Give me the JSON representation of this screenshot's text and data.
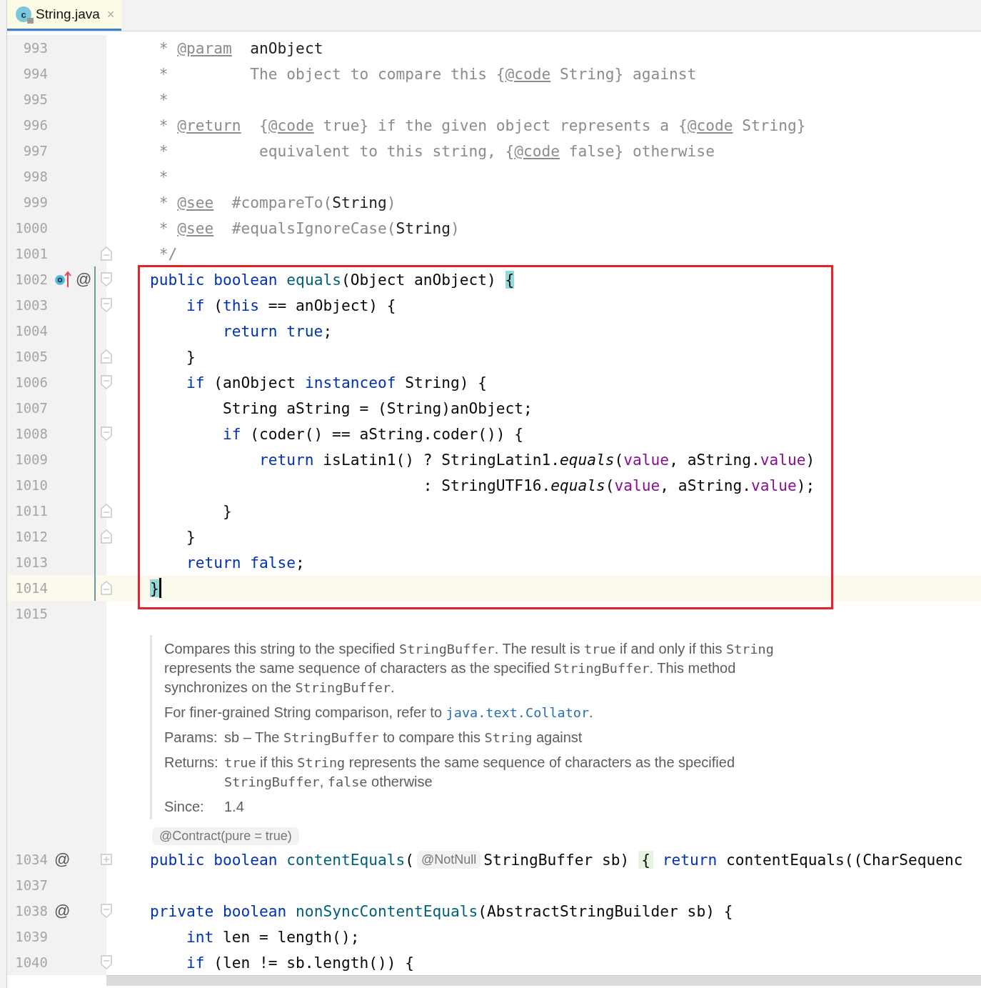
{
  "tab": {
    "label": "String.java",
    "icon_text": "c",
    "close": "×",
    "selected": true
  },
  "lines": [
    {
      "number": "993",
      "tokens": [
        {
          "kind": "comment",
          "text": " * "
        },
        {
          "kind": "doctag",
          "text": "@param"
        },
        {
          "kind": "docref",
          "text": "  anObject"
        }
      ]
    },
    {
      "number": "994",
      "tokens": [
        {
          "kind": "comment",
          "text": " *         The object to compare this {"
        },
        {
          "kind": "doctag",
          "text": "@code"
        },
        {
          "kind": "comment",
          "text": " String} against"
        }
      ]
    },
    {
      "number": "995",
      "tokens": [
        {
          "kind": "comment",
          "text": " *"
        }
      ]
    },
    {
      "number": "996",
      "tokens": [
        {
          "kind": "comment",
          "text": " * "
        },
        {
          "kind": "doctag",
          "text": "@return"
        },
        {
          "kind": "comment",
          "text": "  {"
        },
        {
          "kind": "doctag",
          "text": "@code"
        },
        {
          "kind": "comment",
          "text": " true} if the given object represents a {"
        },
        {
          "kind": "doctag",
          "text": "@code"
        },
        {
          "kind": "comment",
          "text": " String}"
        }
      ]
    },
    {
      "number": "997",
      "tokens": [
        {
          "kind": "comment",
          "text": " *          equivalent to this string, {"
        },
        {
          "kind": "doctag",
          "text": "@code"
        },
        {
          "kind": "comment",
          "text": " false} otherwise"
        }
      ]
    },
    {
      "number": "998",
      "tokens": [
        {
          "kind": "comment",
          "text": " *"
        }
      ]
    },
    {
      "number": "999",
      "tokens": [
        {
          "kind": "comment",
          "text": " * "
        },
        {
          "kind": "doctag",
          "text": "@see"
        },
        {
          "kind": "comment",
          "text": "  #compareTo("
        },
        {
          "kind": "docref",
          "text": "String"
        },
        {
          "kind": "comment",
          "text": ")"
        }
      ]
    },
    {
      "number": "1000",
      "tokens": [
        {
          "kind": "comment",
          "text": " * "
        },
        {
          "kind": "doctag",
          "text": "@see"
        },
        {
          "kind": "comment",
          "text": "  #equalsIgnoreCase("
        },
        {
          "kind": "docref",
          "text": "String"
        },
        {
          "kind": "comment",
          "text": ")"
        }
      ]
    },
    {
      "number": "1001",
      "fold": {
        "kind": "end"
      },
      "tokens": [
        {
          "kind": "comment",
          "text": " */"
        }
      ]
    },
    {
      "kind": "frame",
      "lines": [
        {
          "number": "1002",
          "fold": {
            "kind": "start"
          },
          "in_scope": true,
          "marks": [
            {
              "kind": "override"
            },
            {
              "kind": "at",
              "text": "@"
            }
          ],
          "tokens": [
            {
              "kind": "keyword",
              "text": "public"
            },
            {
              "kind": "keyword",
              "text": " boolean"
            },
            {
              "kind": "method",
              "text": " equals"
            },
            {
              "kind": "plain",
              "text": "(Object anObject) "
            },
            {
              "kind": "brace",
              "text": "{"
            }
          ]
        },
        {
          "number": "1003",
          "fold": {
            "kind": "start"
          },
          "in_scope": true,
          "tokens": [
            {
              "kind": "keyword",
              "text": "    if"
            },
            {
              "kind": "plain",
              "text": " ("
            },
            {
              "kind": "keyword",
              "text": "this"
            },
            {
              "kind": "plain",
              "text": " == anObject) {"
            }
          ]
        },
        {
          "number": "1004",
          "in_scope": true,
          "tokens": [
            {
              "kind": "keyword",
              "text": "        return"
            },
            {
              "kind": "keyword",
              "text": " true"
            },
            {
              "kind": "plain",
              "text": ";"
            }
          ]
        },
        {
          "number": "1005",
          "fold": {
            "kind": "end"
          },
          "in_scope": true,
          "tokens": [
            {
              "kind": "plain",
              "text": "    }"
            }
          ]
        },
        {
          "number": "1006",
          "fold": {
            "kind": "start"
          },
          "in_scope": true,
          "tokens": [
            {
              "kind": "keyword",
              "text": "    if"
            },
            {
              "kind": "plain",
              "text": " (anObject "
            },
            {
              "kind": "keyword",
              "text": "instanceof"
            },
            {
              "kind": "plain",
              "text": " String) {"
            }
          ]
        },
        {
          "number": "1007",
          "in_scope": true,
          "tokens": [
            {
              "kind": "plain",
              "text": "        String aString = (String)anObject;"
            }
          ]
        },
        {
          "number": "1008",
          "fold": {
            "kind": "start"
          },
          "in_scope": true,
          "tokens": [
            {
              "kind": "keyword",
              "text": "        if"
            },
            {
              "kind": "plain",
              "text": " (coder() == aString.coder()) {"
            }
          ]
        },
        {
          "number": "1009",
          "in_scope": true,
          "tokens": [
            {
              "kind": "keyword",
              "text": "            return"
            },
            {
              "kind": "plain",
              "text": " isLatin1() ? StringLatin1."
            },
            {
              "kind": "static",
              "text": "equals"
            },
            {
              "kind": "plain",
              "text": "("
            },
            {
              "kind": "field",
              "text": "value"
            },
            {
              "kind": "plain",
              "text": ", aString."
            },
            {
              "kind": "field",
              "text": "value"
            },
            {
              "kind": "plain",
              "text": ")"
            }
          ]
        },
        {
          "number": "1010",
          "in_scope": true,
          "tokens": [
            {
              "kind": "plain",
              "text": "                              : StringUTF16."
            },
            {
              "kind": "static",
              "text": "equals"
            },
            {
              "kind": "plain",
              "text": "("
            },
            {
              "kind": "field",
              "text": "value"
            },
            {
              "kind": "plain",
              "text": ", aString."
            },
            {
              "kind": "field",
              "text": "value"
            },
            {
              "kind": "plain",
              "text": ");"
            }
          ]
        },
        {
          "number": "1011",
          "fold": {
            "kind": "end"
          },
          "in_scope": true,
          "tokens": [
            {
              "kind": "plain",
              "text": "        }"
            }
          ]
        },
        {
          "number": "1012",
          "fold": {
            "kind": "end"
          },
          "in_scope": true,
          "tokens": [
            {
              "kind": "plain",
              "text": "    }"
            }
          ]
        },
        {
          "number": "1013",
          "in_scope": true,
          "tokens": [
            {
              "kind": "keyword",
              "text": "    return"
            },
            {
              "kind": "keyword",
              "text": " false"
            },
            {
              "kind": "plain",
              "text": ";"
            }
          ]
        },
        {
          "number": "1014",
          "fold": {
            "kind": "end"
          },
          "in_scope": true,
          "current": true,
          "caret": true,
          "tokens": [
            {
              "kind": "brace",
              "text": "}"
            }
          ]
        }
      ]
    },
    {
      "number": "1015"
    },
    {
      "kind": "doc",
      "blocks": [
        {
          "kind": "para",
          "segments": [
            {
              "kind": "text",
              "text": "Compares this string to the specified "
            },
            {
              "kind": "code",
              "text": "StringBuffer"
            },
            {
              "kind": "text",
              "text": ". The result is "
            },
            {
              "kind": "code",
              "text": "true"
            },
            {
              "kind": "text",
              "text": " if and only if this "
            },
            {
              "kind": "code",
              "text": "String"
            },
            {
              "kind": "text",
              "text": " represents the same sequence of characters as the specified "
            },
            {
              "kind": "code",
              "text": "StringBuffer"
            },
            {
              "kind": "text",
              "text": ". This method synchronizes on the "
            },
            {
              "kind": "code",
              "text": "StringBuffer"
            },
            {
              "kind": "text",
              "text": "."
            }
          ]
        },
        {
          "kind": "para",
          "segments": [
            {
              "kind": "text",
              "text": "For finer-grained String comparison, refer to "
            },
            {
              "kind": "link",
              "text": "java.text.Collator"
            },
            {
              "kind": "text",
              "text": "."
            }
          ]
        },
        {
          "kind": "field",
          "label": "Params:",
          "segments": [
            {
              "kind": "text",
              "text": "sb – The "
            },
            {
              "kind": "code",
              "text": "StringBuffer"
            },
            {
              "kind": "text",
              "text": " to compare this "
            },
            {
              "kind": "code",
              "text": "String"
            },
            {
              "kind": "text",
              "text": " against"
            }
          ]
        },
        {
          "kind": "field",
          "label": "Returns:",
          "segments": [
            {
              "kind": "code",
              "text": "true"
            },
            {
              "kind": "text",
              "text": " if this "
            },
            {
              "kind": "code",
              "text": "String"
            },
            {
              "kind": "text",
              "text": " represents the same sequence of characters as the specified "
            },
            {
              "kind": "code",
              "text": "StringBuffer"
            },
            {
              "kind": "text",
              "text": ", "
            },
            {
              "kind": "code",
              "text": "false"
            },
            {
              "kind": "text",
              "text": " otherwise"
            }
          ]
        },
        {
          "kind": "field",
          "label": "Since:",
          "segments": [
            {
              "kind": "text",
              "text": "1.4"
            }
          ]
        }
      ]
    },
    {
      "number": "1034",
      "fold": {
        "kind": "collapsed"
      },
      "hint": "@Contract(pure = true)",
      "marks": [
        {
          "kind": "at",
          "text": "@"
        }
      ],
      "tokens": [
        {
          "kind": "keyword",
          "text": "public"
        },
        {
          "kind": "keyword",
          "text": " boolean"
        },
        {
          "kind": "method",
          "text": " contentEquals"
        },
        {
          "kind": "plain",
          "text": "("
        },
        {
          "kind": "inlay",
          "text": "@NotNull"
        },
        {
          "kind": "plain",
          "text": "StringBuffer sb) "
        },
        {
          "kind": "folded",
          "text": "{"
        },
        {
          "kind": "keyword",
          "text": " return"
        },
        {
          "kind": "plain",
          "text": " contentEquals((CharSequenc"
        }
      ]
    },
    {
      "number": "1037"
    },
    {
      "number": "1038",
      "fold": {
        "kind": "start"
      },
      "marks": [
        {
          "kind": "at",
          "text": "@"
        }
      ],
      "tokens": [
        {
          "kind": "keyword",
          "text": "private"
        },
        {
          "kind": "keyword",
          "text": " boolean"
        },
        {
          "kind": "method",
          "text": " nonSyncContentEquals"
        },
        {
          "kind": "plain",
          "text": "(AbstractStringBuilder sb) {"
        }
      ]
    },
    {
      "number": "1039",
      "tokens": [
        {
          "kind": "keyword",
          "text": "    int"
        },
        {
          "kind": "plain",
          "text": " len = length();"
        }
      ]
    },
    {
      "number": "1040",
      "fold": {
        "kind": "start"
      },
      "tokens": [
        {
          "kind": "keyword",
          "text": "    if"
        },
        {
          "kind": "plain",
          "text": " (len != sb.length()) {"
        }
      ]
    }
  ]
}
